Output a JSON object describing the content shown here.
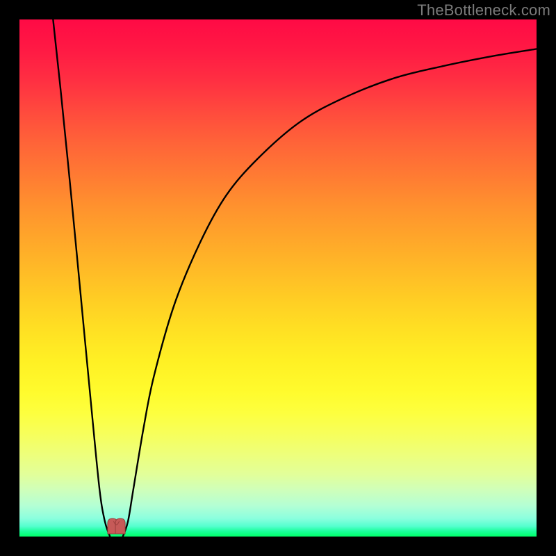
{
  "watermark": "TheBottleneck.com",
  "colors": {
    "frame": "#000000",
    "curve": "#000000",
    "marker_fill": "#c65a58",
    "marker_stroke": "#9a3e3c"
  },
  "chart_data": {
    "type": "line",
    "title": "",
    "xlabel": "",
    "ylabel": "",
    "xlim": [
      0,
      100
    ],
    "ylim": [
      0,
      100
    ],
    "grid": false,
    "legend": false,
    "note": "Values are visual estimates; chart has no numeric axes. y is distance from bottom (0=green baseline, 100=top edge).",
    "series": [
      {
        "name": "left-branch",
        "x": [
          6.5,
          8,
          10,
          12,
          14,
          15.5,
          16.5,
          17.5
        ],
        "y": [
          100,
          86,
          66,
          45,
          24,
          9,
          3,
          0
        ]
      },
      {
        "name": "right-branch",
        "x": [
          20,
          21,
          22,
          24,
          26,
          30,
          35,
          40,
          46,
          54,
          62,
          72,
          82,
          92,
          100
        ],
        "y": [
          0,
          3,
          9,
          21,
          31,
          45,
          57,
          66,
          73,
          80,
          84.5,
          88.5,
          91,
          93,
          94.3
        ]
      }
    ],
    "markers": {
      "name": "valley-marker",
      "x": [
        18,
        19.5
      ],
      "y": [
        0.5,
        0.5
      ],
      "shape": "u-pair"
    }
  }
}
